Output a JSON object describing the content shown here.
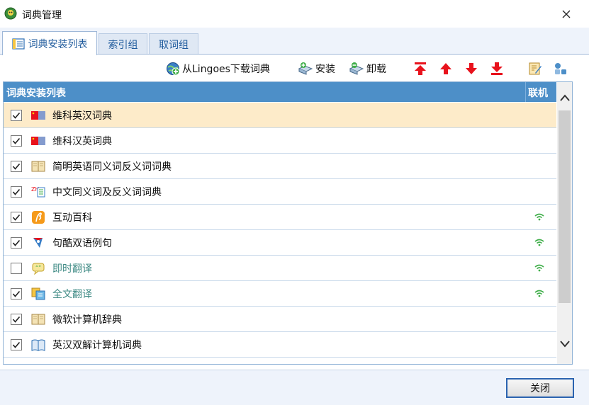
{
  "window": {
    "title": "词典管理"
  },
  "tabs": [
    {
      "label": "词典安装列表"
    },
    {
      "label": "索引组"
    },
    {
      "label": "取词组"
    }
  ],
  "toolbar": {
    "download_label": "从Lingoes下载词典",
    "install_label": "安装",
    "uninstall_label": "卸载"
  },
  "grid": {
    "col_name": "词典安装列表",
    "col_online": "联机",
    "rows": [
      {
        "label": "维科英汉词典",
        "checked": true,
        "online": false,
        "icon": "flag-icon"
      },
      {
        "label": "维科汉英词典",
        "checked": true,
        "online": false,
        "icon": "flag-icon"
      },
      {
        "label": "简明英语同义词反义词词典",
        "checked": true,
        "online": false,
        "icon": "book-icon"
      },
      {
        "label": "中文同义词及反义词词典",
        "checked": true,
        "online": false,
        "icon": "zh-icon"
      },
      {
        "label": "互动百科",
        "checked": true,
        "online": true,
        "icon": "hudong-icon"
      },
      {
        "label": "句酷双语例句",
        "checked": true,
        "online": true,
        "icon": "juku-icon"
      },
      {
        "label": "即时翻译",
        "checked": false,
        "online": true,
        "icon": "chat-icon"
      },
      {
        "label": "全文翻译",
        "checked": true,
        "online": true,
        "icon": "translate-icon"
      },
      {
        "label": "微软计算机辞典",
        "checked": true,
        "online": false,
        "icon": "book-icon"
      },
      {
        "label": "英汉双解计算机词典",
        "checked": true,
        "online": false,
        "icon": "open-book-icon"
      }
    ]
  },
  "footer": {
    "close_label": "关闭"
  },
  "colors": {
    "header_blue": "#4d8fc8",
    "selected_row": "#fdebc9",
    "online_text": "#3e8a84",
    "arrow_red": "#e8121c",
    "wifi_green": "#3fae49"
  }
}
